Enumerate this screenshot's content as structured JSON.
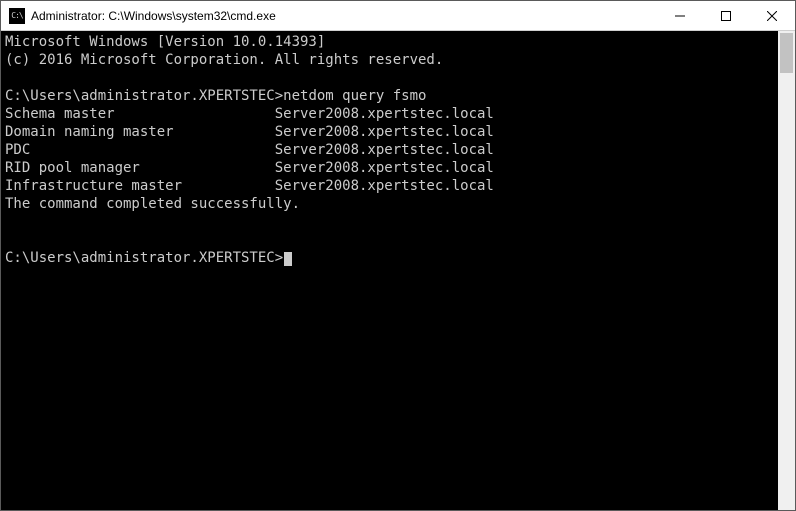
{
  "titlebar": {
    "icon_name": "cmd-icon",
    "title": "Administrator: C:\\Windows\\system32\\cmd.exe",
    "minimize_label": "Minimize",
    "maximize_label": "Maximize",
    "close_label": "Close"
  },
  "terminal": {
    "header_line1": "Microsoft Windows [Version 10.0.14393]",
    "header_line2": "(c) 2016 Microsoft Corporation. All rights reserved.",
    "prompt1_path": "C:\\Users\\administrator.XPERTSTEC>",
    "prompt1_command": "netdom query fsmo",
    "results": [
      {
        "role": "Schema master",
        "server": "Server2008.xpertstec.local"
      },
      {
        "role": "Domain naming master",
        "server": "Server2008.xpertstec.local"
      },
      {
        "role": "PDC",
        "server": "Server2008.xpertstec.local"
      },
      {
        "role": "RID pool manager",
        "server": "Server2008.xpertstec.local"
      },
      {
        "role": "Infrastructure master",
        "server": "Server2008.xpertstec.local"
      }
    ],
    "completion_message": "The command completed successfully.",
    "prompt2_path": "C:\\Users\\administrator.XPERTSTEC>"
  }
}
